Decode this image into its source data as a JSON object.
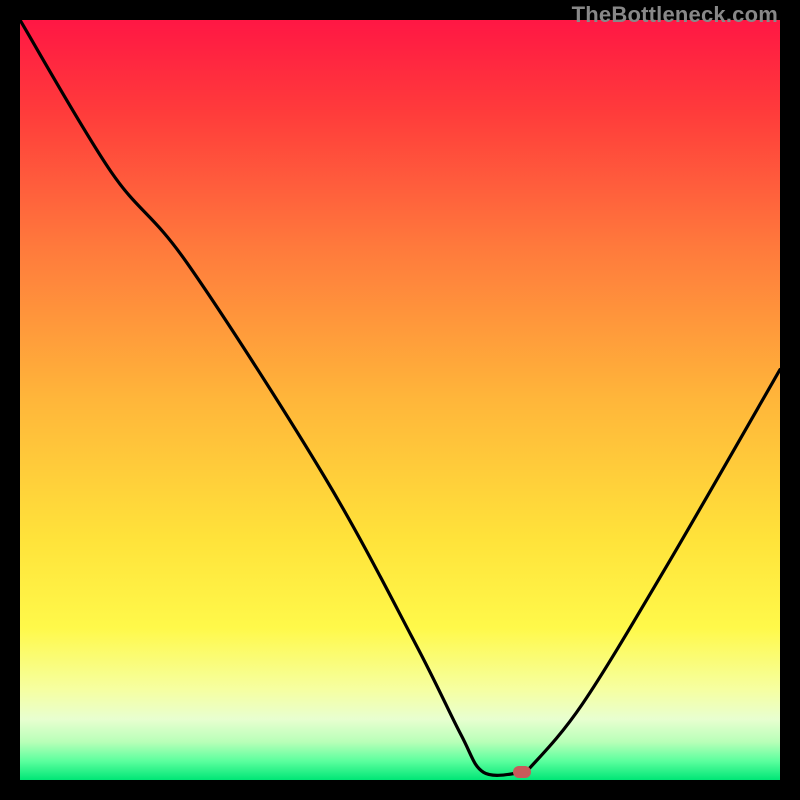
{
  "watermark": "TheBottleneck.com",
  "chart_data": {
    "type": "line",
    "title": "",
    "xlabel": "",
    "ylabel": "",
    "x_range": [
      0,
      100
    ],
    "y_range": [
      0,
      100
    ],
    "curve_points": [
      {
        "x": 0,
        "y": 100
      },
      {
        "x": 12,
        "y": 80
      },
      {
        "x": 22,
        "y": 68
      },
      {
        "x": 40,
        "y": 40
      },
      {
        "x": 52,
        "y": 18
      },
      {
        "x": 58,
        "y": 6
      },
      {
        "x": 61,
        "y": 1
      },
      {
        "x": 66,
        "y": 1
      },
      {
        "x": 67,
        "y": 1.5
      },
      {
        "x": 74,
        "y": 10
      },
      {
        "x": 85,
        "y": 28
      },
      {
        "x": 100,
        "y": 54
      }
    ],
    "optimal_point": {
      "x": 66,
      "y": 1
    },
    "gradient_stops": [
      {
        "offset": 0.0,
        "color": "#ff1744"
      },
      {
        "offset": 0.12,
        "color": "#ff3b3b"
      },
      {
        "offset": 0.3,
        "color": "#ff7a3c"
      },
      {
        "offset": 0.5,
        "color": "#ffb63a"
      },
      {
        "offset": 0.68,
        "color": "#ffe23a"
      },
      {
        "offset": 0.8,
        "color": "#fff94a"
      },
      {
        "offset": 0.88,
        "color": "#f6ffa0"
      },
      {
        "offset": 0.92,
        "color": "#e8ffd0"
      },
      {
        "offset": 0.95,
        "color": "#b8ffb8"
      },
      {
        "offset": 0.975,
        "color": "#5cff9e"
      },
      {
        "offset": 1.0,
        "color": "#00e676"
      }
    ]
  }
}
